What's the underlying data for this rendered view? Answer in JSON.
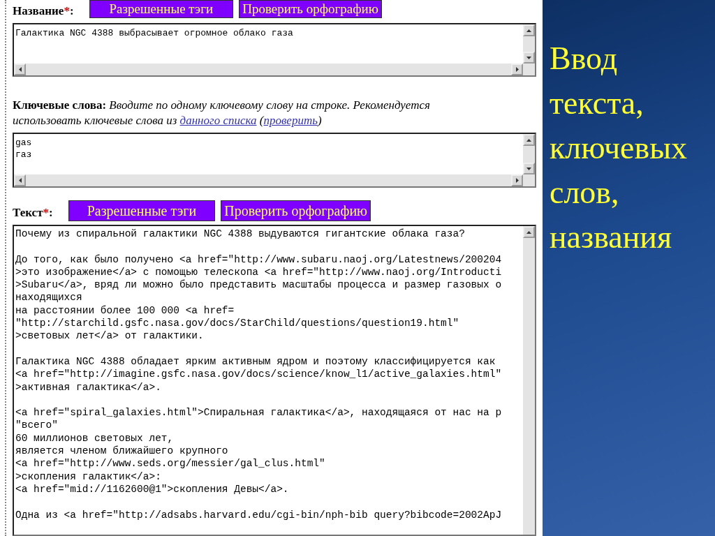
{
  "form": {
    "title_field": {
      "label": "Название",
      "marker": "*",
      "label_end": ":",
      "lines": [
        "Галактика NGC 4388 выбрасывает огромное облако газа"
      ]
    },
    "title_buttons": [
      {
        "label": "Разрешенные тэги"
      },
      {
        "label": "Проверить орфографию"
      }
    ],
    "keywords_hint": [
      {
        "kind": "bold",
        "text": "Ключевые слова:"
      },
      {
        "kind": "italic",
        "text": " Вводите по одному ключевому слову на строке. Рекомендуется использовать ключевые слова из "
      },
      {
        "kind": "link",
        "text": "данного списка"
      },
      {
        "kind": "italic",
        "text": " ("
      },
      {
        "kind": "link",
        "text": "проверить"
      },
      {
        "kind": "italic",
        "text": ")"
      }
    ],
    "keywords_field": {
      "lines": [
        "gas",
        "газ"
      ]
    },
    "text_field": {
      "label": "Текст",
      "marker": "*",
      "label_end": ":",
      "paragraphs": [
        [
          "Почему из спиральной галактики NGC 4388 выдуваются гигантские облака газа?"
        ],
        [
          "До того, как было получено <a href=\"http://www.subaru.naoj.org/Latestnews/200204",
          ">это изображение</a> с помощью телескопа <a href=\"http://www.naoj.org/Introducti",
          ">Subaru</a>, вряд ли можно было представить масштабы процесса и размер газовых о",
          "находящихся",
          "на расстоянии более 100 000 <a href=",
          "\"http://starchild.gsfc.nasa.gov/docs/StarChild/questions/question19.html\"",
          ">световых лет</a> от галактики."
        ],
        [
          "Галактика NGC 4388 обладает ярким активным ядром и поэтому классифицируется как",
          "<a href=\"http://imagine.gsfc.nasa.gov/docs/science/know_l1/active_galaxies.html\"",
          ">активная галактика</a>."
        ],
        [
          "<a href=\"spiral_galaxies.html\">Спиральная галактика</a>, находящаяся от нас на р",
          "\"всего\"",
          "60 миллионов световых лет,",
          "является членом ближайшего крупного",
          "<a href=\"http://www.seds.org/messier/gal_clus.html\"",
          ">скопления галактик</a>:",
          "<a href=\"mid://1162600@1\">скопления Девы</a>."
        ],
        [
          "Одна из <a href=\"http://adsabs.harvard.edu/cgi-bin/nph-bib query?bibcode=2002ApJ"
        ]
      ]
    },
    "text_buttons": [
      {
        "label": "Разрешенные тэги"
      },
      {
        "label": "Проверить орфографию"
      }
    ]
  },
  "slide_title": "Ввод текста, ключевых слов, названия"
}
